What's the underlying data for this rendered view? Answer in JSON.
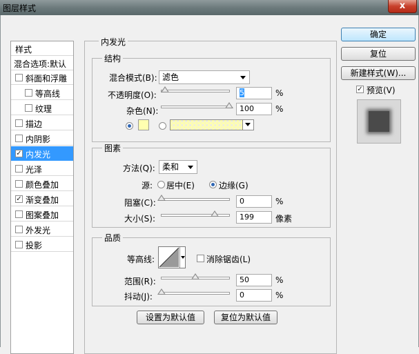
{
  "window": {
    "title": "图层样式",
    "close_glyph": "x"
  },
  "left_panel": {
    "header": "样式",
    "blend_options": "混合选项:默认",
    "items": [
      {
        "label": "斜面和浮雕",
        "checked": false
      },
      {
        "label": "等高线",
        "checked": false
      },
      {
        "label": "纹理",
        "checked": false
      },
      {
        "label": "描边",
        "checked": false
      },
      {
        "label": "内阴影",
        "checked": false
      },
      {
        "label": "内发光",
        "checked": true
      },
      {
        "label": "光泽",
        "checked": false
      },
      {
        "label": "颜色叠加",
        "checked": false
      },
      {
        "label": "渐变叠加",
        "checked": true
      },
      {
        "label": "图案叠加",
        "checked": false
      },
      {
        "label": "外发光",
        "checked": false
      },
      {
        "label": "投影",
        "checked": false
      }
    ]
  },
  "main": {
    "title": "内发光",
    "structure": {
      "legend": "结构",
      "blend_mode_label": "混合模式(B):",
      "blend_mode_value": "滤色",
      "opacity_label": "不透明度(O):",
      "opacity_value": "5",
      "opacity_unit": "%",
      "opacity_level": 0.05,
      "noise_label": "杂色(N):",
      "noise_value": "100",
      "noise_unit": "%",
      "noise_level": 1.0,
      "solid_color": "#ffffb0",
      "gradient_color": "#ffffb0"
    },
    "elements": {
      "legend": "图素",
      "method_label": "方法(Q):",
      "method_value": "柔和",
      "source_label": "源:",
      "source_center": "居中(E)",
      "source_edge": "边缘(G)",
      "choke_label": "阻塞(C):",
      "choke_value": "0",
      "choke_unit": "%",
      "choke_level": 0.0,
      "size_label": "大小(S):",
      "size_value": "199",
      "size_unit": "像素",
      "size_level": 0.79
    },
    "quality": {
      "legend": "品质",
      "contour_label": "等高线:",
      "antialias_label": "消除锯齿(L)",
      "range_label": "范围(R):",
      "range_value": "50",
      "range_unit": "%",
      "range_level": 0.5,
      "jitter_label": "抖动(J):",
      "jitter_value": "0",
      "jitter_unit": "%",
      "jitter_level": 0.0
    },
    "make_default": "设置为默认值",
    "reset_default": "复位为默认值"
  },
  "buttons": {
    "ok": "确定",
    "reset": "复位",
    "new_style": "新建样式(W)...",
    "preview_label": "预览(V)"
  }
}
